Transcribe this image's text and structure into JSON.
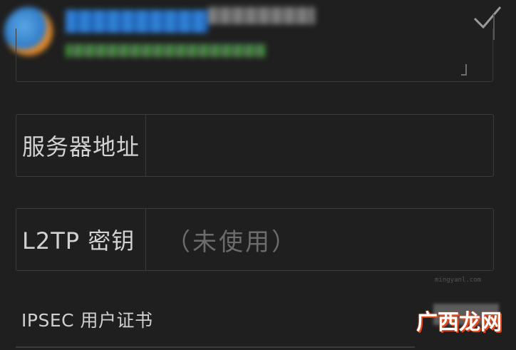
{
  "form": {
    "fields": [
      {
        "label": "服务器地址",
        "value": ""
      },
      {
        "label": "L2TP 密钥",
        "value": "（未使用）"
      }
    ],
    "ipsec_label": "IPSEC 用户证书"
  },
  "watermark": {
    "site_name": "广西龙网",
    "url": "mingyanl.com"
  },
  "icons": {
    "confirm": "check-icon"
  },
  "colors": {
    "background": "#1f1f1f",
    "border": "#3b3b3b",
    "label_text": "#d2d2d2",
    "placeholder_text": "#6c6c6c"
  }
}
